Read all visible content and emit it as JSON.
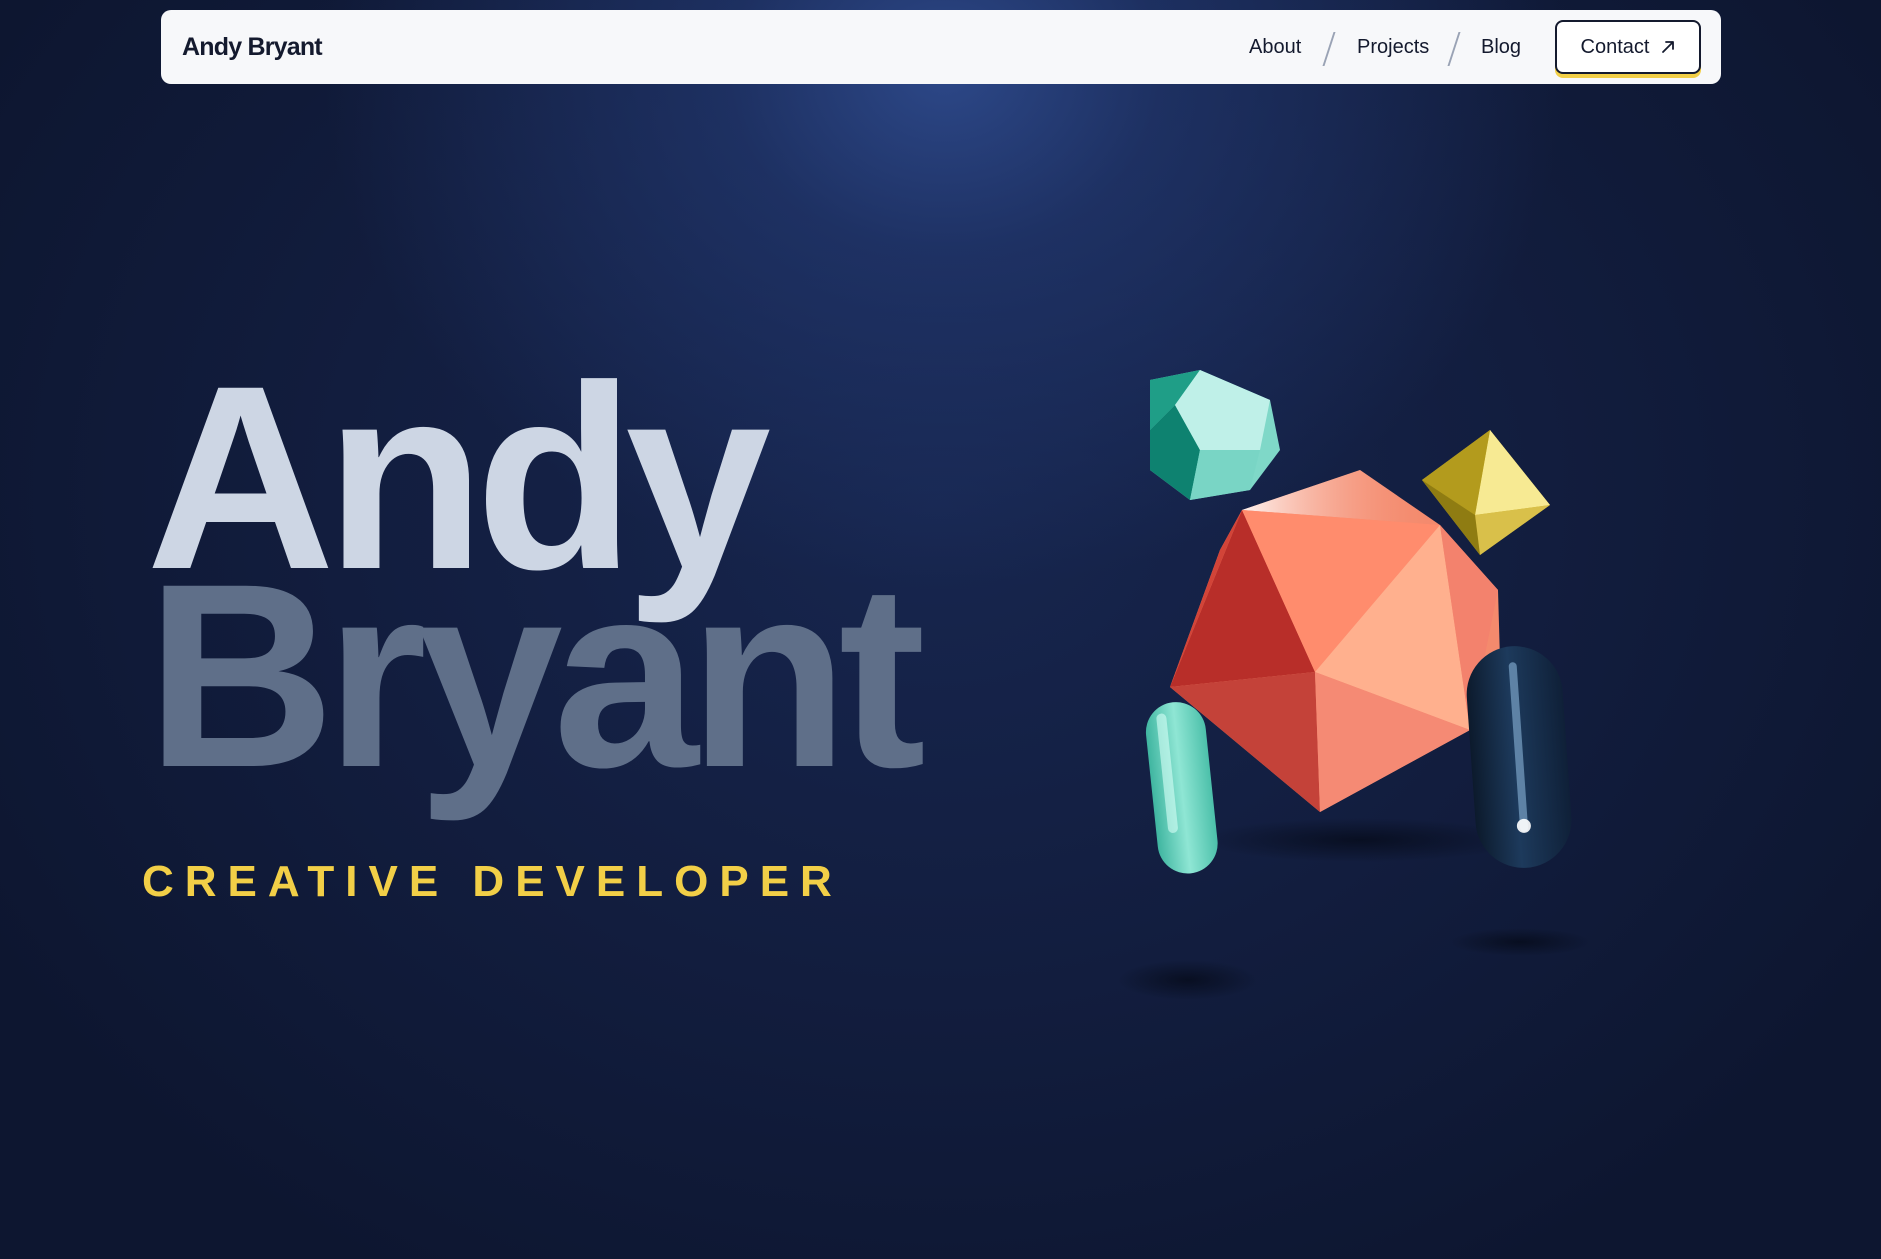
{
  "navbar": {
    "brand": "Andy Bryant",
    "links": [
      {
        "label": "About"
      },
      {
        "label": "Projects"
      },
      {
        "label": "Blog"
      }
    ],
    "contact": {
      "label": "Contact",
      "icon": "arrow-up-right-icon"
    }
  },
  "hero": {
    "first_name": "Andy",
    "last_name": "Bryant",
    "tagline": "CREATIVE DEVELOPER"
  },
  "colors": {
    "accent_yellow": "#f2cf47",
    "name_light": "#cdd6e4",
    "name_dim": "#5f6f89",
    "navbar_bg": "#f7f8fa",
    "background": "#121d3e",
    "coral": "#f48a6d",
    "teal": "#7fd8c8",
    "navy_capsule": "#1b3656"
  },
  "artwork": {
    "shapes": [
      "teal-dodecahedron",
      "coral-icosahedron",
      "yellow-octahedron",
      "teal-capsule",
      "navy-capsule"
    ]
  }
}
